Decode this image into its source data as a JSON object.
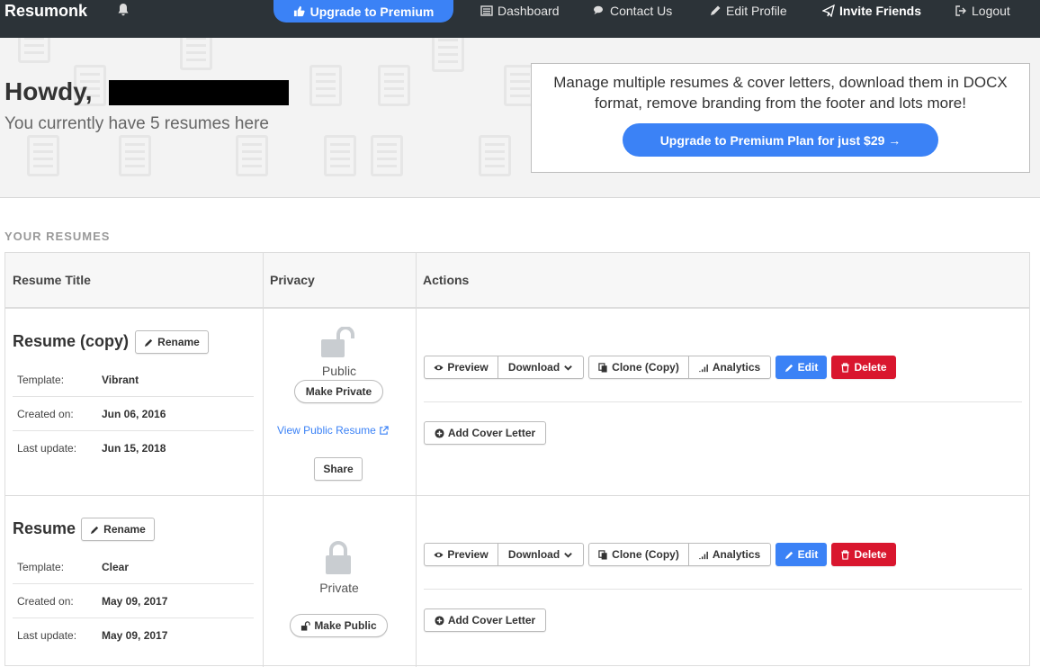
{
  "nav": {
    "brand": "Resumonk",
    "upgrade": "Upgrade to Premium",
    "dashboard": "Dashboard",
    "contact": "Contact Us",
    "edit_profile": "Edit Profile",
    "invite": "Invite Friends",
    "logout": "Logout"
  },
  "hero": {
    "greeting": "Howdy,",
    "subtitle": "You currently have 5 resumes here",
    "promo_text": "Manage multiple resumes & cover letters, download them in DOCX format, remove branding from the footer and lots more!",
    "promo_button": "Upgrade to Premium Plan for just $29 →"
  },
  "section": {
    "title": "YOUR RESUMES"
  },
  "table": {
    "headers": [
      "Resume Title",
      "Privacy",
      "Actions"
    ]
  },
  "actions": {
    "preview": "Preview",
    "download": "Download",
    "clone": "Clone (Copy)",
    "analytics": "Analytics",
    "edit": "Edit",
    "delete": "Delete",
    "add_cover": "Add Cover Letter",
    "rename": "Rename",
    "share": "Share",
    "view_public": "View Public Resume"
  },
  "labels": {
    "template": "Template:",
    "created": "Created on:",
    "updated": "Last update:"
  },
  "resumes": [
    {
      "title": "Resume (copy)",
      "template": "Vibrant",
      "created": "Jun 06, 2016",
      "updated": "Jun 15, 2018",
      "privacy": "Public",
      "privacy_button": "Make Private"
    },
    {
      "title": "Resume",
      "template": "Clear",
      "created": "May 09, 2017",
      "updated": "May 09, 2017",
      "privacy": "Private",
      "privacy_button": "Make Public"
    }
  ],
  "colors": {
    "nav_bg": "#2c3338",
    "accent": "#3b82f6",
    "danger": "#d9162e"
  }
}
